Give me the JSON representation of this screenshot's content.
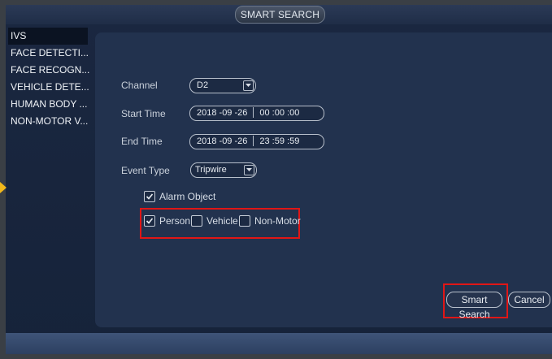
{
  "window": {
    "title": "SMART SEARCH"
  },
  "sidebar": {
    "items": [
      {
        "label": "IVS",
        "active": true
      },
      {
        "label": "FACE DETECTI..."
      },
      {
        "label": "FACE RECOGN..."
      },
      {
        "label": "VEHICLE DETE..."
      },
      {
        "label": "HUMAN BODY ..."
      },
      {
        "label": "NON-MOTOR V..."
      }
    ]
  },
  "form": {
    "channel": {
      "label": "Channel",
      "value": "D2"
    },
    "start_time": {
      "label": "Start Time",
      "date": "2018 -09 -26",
      "time": "00 :00 :00"
    },
    "end_time": {
      "label": "End Time",
      "date": "2018 -09 -26",
      "time": "23 :59 :59"
    },
    "event_type": {
      "label": "Event Type",
      "value": "Tripwire"
    },
    "alarm_object": {
      "label": "Alarm Object",
      "checked": true
    },
    "objects": [
      {
        "label": "Person",
        "checked": true
      },
      {
        "label": "Vehicle",
        "checked": false
      },
      {
        "label": "Non-Motor",
        "checked": false
      }
    ]
  },
  "buttons": {
    "smart_search": "Smart Search",
    "cancel": "Cancel"
  },
  "colors": {
    "highlight": "#e01616",
    "pointer": "#f2b81b",
    "panel": "#22324e"
  },
  "icons": {
    "dropdown": "chevron-down-icon",
    "check": "check-icon",
    "pointer": "arrow-right-icon"
  }
}
